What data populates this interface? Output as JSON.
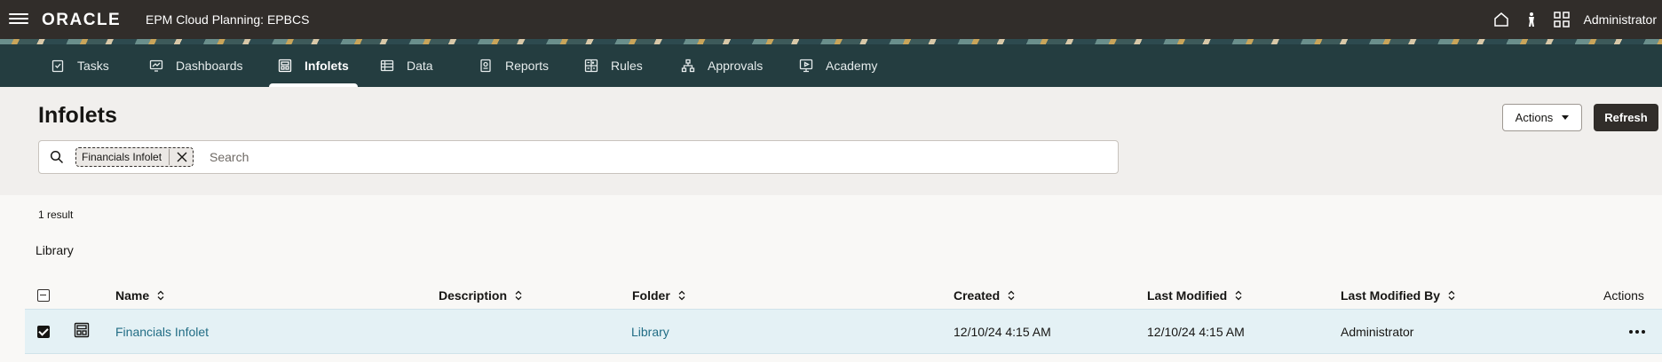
{
  "header": {
    "logo": "ORACLE",
    "app_title": "EPM Cloud Planning: EPBCS",
    "user": "Administrator",
    "icons": [
      "home-icon",
      "accessibility-icon",
      "navigator-grid-icon"
    ]
  },
  "nav": {
    "tabs": [
      {
        "label": "Tasks",
        "icon": "tasks-icon"
      },
      {
        "label": "Dashboards",
        "icon": "dashboards-icon"
      },
      {
        "label": "Infolets",
        "icon": "infolets-icon",
        "active": true
      },
      {
        "label": "Data",
        "icon": "data-icon"
      },
      {
        "label": "Reports",
        "icon": "reports-icon"
      },
      {
        "label": "Rules",
        "icon": "rules-icon"
      },
      {
        "label": "Approvals",
        "icon": "approvals-icon"
      },
      {
        "label": "Academy",
        "icon": "academy-icon"
      }
    ]
  },
  "page": {
    "title": "Infolets",
    "actions_label": "Actions",
    "refresh_label": "Refresh"
  },
  "search": {
    "chip_label": "Financials Infolet",
    "placeholder": "Search"
  },
  "results": {
    "count_text": "1 result",
    "library_label": "Library"
  },
  "table": {
    "columns": [
      "Name",
      "Description",
      "Folder",
      "Created",
      "Last Modified",
      "Last Modified By",
      "Actions"
    ],
    "rows": [
      {
        "name": "Financials Infolet",
        "description": "",
        "folder": "Library",
        "created": "12/10/24 4:15 AM",
        "last_modified": "12/10/24 4:15 AM",
        "last_modified_by": "Administrator",
        "selected": true
      }
    ]
  },
  "colors": {
    "topbar": "#312d2a",
    "navbar": "#243d40",
    "link": "#226d85",
    "row_selected": "#e4f1f5"
  }
}
